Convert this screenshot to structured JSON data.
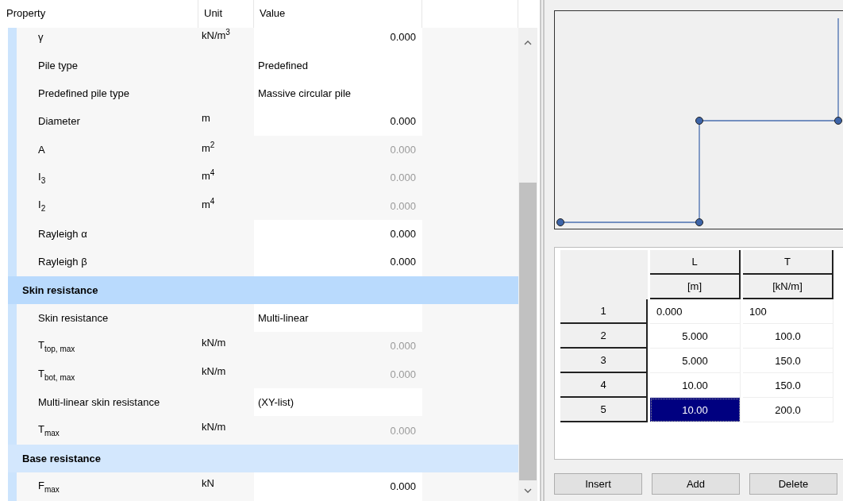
{
  "grid": {
    "columns": [
      "Property",
      "Unit",
      "Value"
    ],
    "rows": [
      {
        "kind": "number",
        "label": "γ",
        "unit": "kN/m$^{3}$",
        "value": "0.000",
        "editable": true
      },
      {
        "kind": "choice",
        "label": "Pile type",
        "value": "Predefined",
        "editable": true
      },
      {
        "kind": "choice",
        "label": "Predefined pile type",
        "value": "Massive circular pile",
        "editable": true
      },
      {
        "kind": "number",
        "label": "Diameter",
        "unit": "m",
        "value": "0.000",
        "editable": true
      },
      {
        "kind": "number",
        "label": "A",
        "unit": "m$^{2}$",
        "value": "0.000",
        "editable": false
      },
      {
        "kind": "number",
        "label": "I$_{3}$",
        "unit": "m$^{4}$",
        "value": "0.000",
        "editable": false
      },
      {
        "kind": "number",
        "label": "I$_{2}$",
        "unit": "m$^{4}$",
        "value": "0.000",
        "editable": false
      },
      {
        "kind": "number",
        "label": "Rayleigh α",
        "value": "0.000",
        "editable": true
      },
      {
        "kind": "number",
        "label": "Rayleigh β",
        "value": "0.000",
        "editable": true
      },
      {
        "kind": "group",
        "label": "Skin resistance",
        "selected": true
      },
      {
        "kind": "choice",
        "label": "Skin resistance",
        "value": "Multi-linear",
        "editable": true
      },
      {
        "kind": "number",
        "label": "T$_{top, max}$",
        "unit": "kN/m",
        "value": "0.000",
        "editable": false
      },
      {
        "kind": "number",
        "label": "T$_{bot, max}$",
        "unit": "kN/m",
        "value": "0.000",
        "editable": false
      },
      {
        "kind": "choice",
        "label": "Multi-linear skin resistance",
        "value": "(XY-list)",
        "editable": true
      },
      {
        "kind": "number",
        "label": "T$_{max}$",
        "unit": "kN/m",
        "value": "0.000",
        "editable": false
      },
      {
        "kind": "group",
        "label": "Base resistance",
        "selected": false
      },
      {
        "kind": "number",
        "label": "F$_{max}$",
        "unit": "kN",
        "value": "0.000",
        "editable": true
      }
    ]
  },
  "table": {
    "columns": [
      {
        "name": "L",
        "unit": "[m]"
      },
      {
        "name": "T",
        "unit": "[kN/m]"
      }
    ],
    "rows": [
      {
        "index": "1",
        "editing": true,
        "cells": [
          {
            "value": "0.000",
            "selected": false
          },
          {
            "value": "100",
            "selected": false
          }
        ]
      },
      {
        "index": "2",
        "editing": false,
        "cells": [
          {
            "value": "5.000",
            "selected": false
          },
          {
            "value": "100.0",
            "selected": false
          }
        ]
      },
      {
        "index": "3",
        "editing": false,
        "cells": [
          {
            "value": "5.000",
            "selected": false
          },
          {
            "value": "150.0",
            "selected": false
          }
        ]
      },
      {
        "index": "4",
        "editing": false,
        "cells": [
          {
            "value": "10.00",
            "selected": false
          },
          {
            "value": "150.0",
            "selected": false
          }
        ]
      },
      {
        "index": "5",
        "editing": false,
        "cells": [
          {
            "value": "10.00",
            "selected": true
          },
          {
            "value": "200.0",
            "selected": false
          }
        ]
      }
    ]
  },
  "buttons": [
    "Insert",
    "Add",
    "Delete"
  ]
}
